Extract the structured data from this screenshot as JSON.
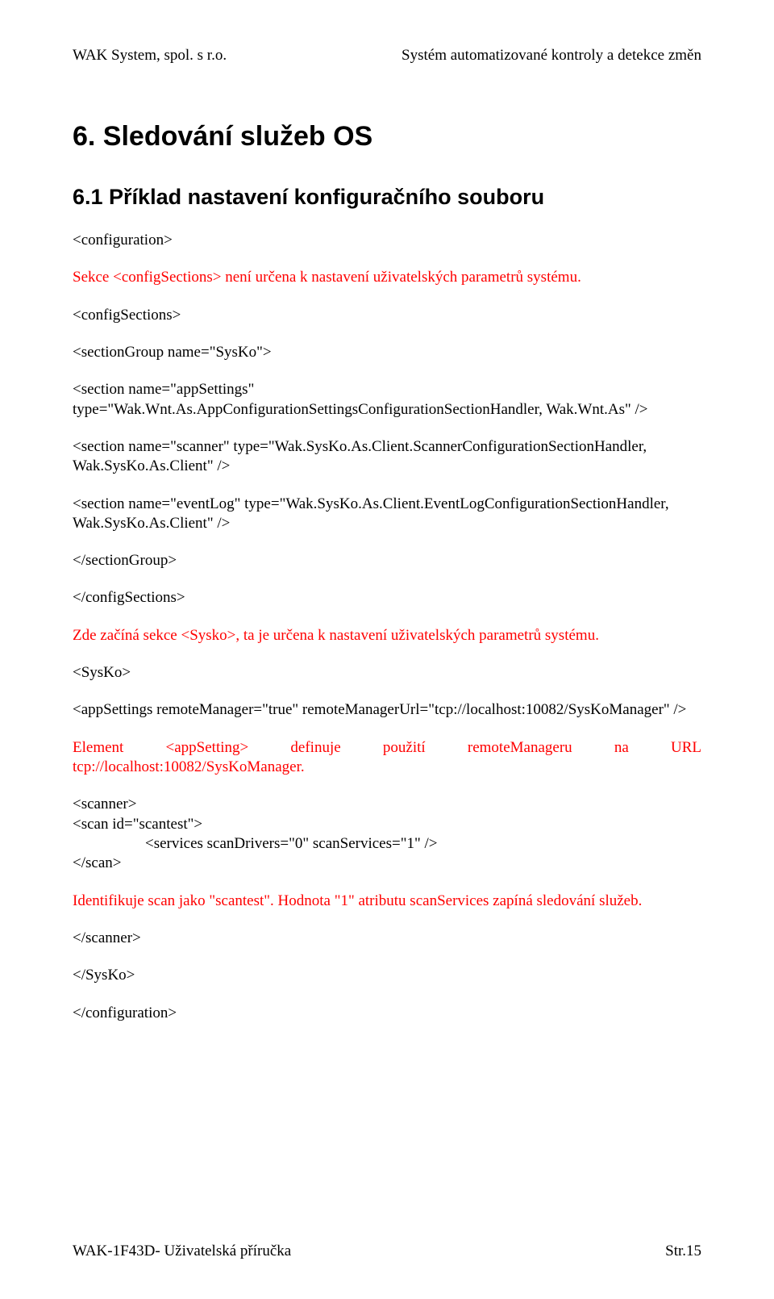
{
  "header": {
    "left": "WAK System, spol. s r.o.",
    "right": "Systém automatizované kontroly a detekce změn"
  },
  "h1": "6. Sledování služeb OS",
  "h2": "6.1 Příklad nastavení konfiguračního souboru",
  "p1": "<configuration>",
  "p2": "Sekce <configSections> není určena k nastavení uživatelských parametrů systému.",
  "p3": "<configSections>",
  "p4": "<sectionGroup name=\"SysKo\">",
  "p5": "<section name=\"appSettings\" type=\"Wak.Wnt.As.AppConfigurationSettingsConfigurationSectionHandler, Wak.Wnt.As\" />",
  "p6": "<section name=\"scanner\" type=\"Wak.SysKo.As.Client.ScannerConfigurationSectionHandler, Wak.SysKo.As.Client\" />",
  "p7": "<section name=\"eventLog\" type=\"Wak.SysKo.As.Client.EventLogConfigurationSectionHandler, Wak.SysKo.As.Client\" />",
  "p8": "</sectionGroup>",
  "p9": "</configSections>",
  "p10": "Zde  začíná sekce <Sysko>, ta je určena k nastavení uživatelských parametrů systému.",
  "p11": "<SysKo>",
  "p12": "<appSettings remoteManager=\"true\" remoteManagerUrl=\"tcp://localhost:10082/SysKoManager\" />",
  "p13a": "Element",
  "p13b": "<appSetting>",
  "p13c": "definuje",
  "p13d": "použití",
  "p13e": "remoteManageru",
  "p13f": "na",
  "p13g": "URL",
  "p13_2": "tcp://localhost:10082/SysKoManager.",
  "p14": "<scanner>",
  "p15": "<scan id=\"scantest\">",
  "p16": "<services scanDrivers=\"0\" scanServices=\"1\" />",
  "p17": "</scan>",
  "p18": "Identifikuje scan jako \"scantest\". Hodnota \"1\" atributu scanServices zapíná sledování služeb.",
  "p19": "</scanner>",
  "p20": "</SysKo>",
  "p21": "</configuration>",
  "footer": {
    "left": "WAK-1F43D- Uživatelská příručka",
    "right": "Str.15"
  }
}
